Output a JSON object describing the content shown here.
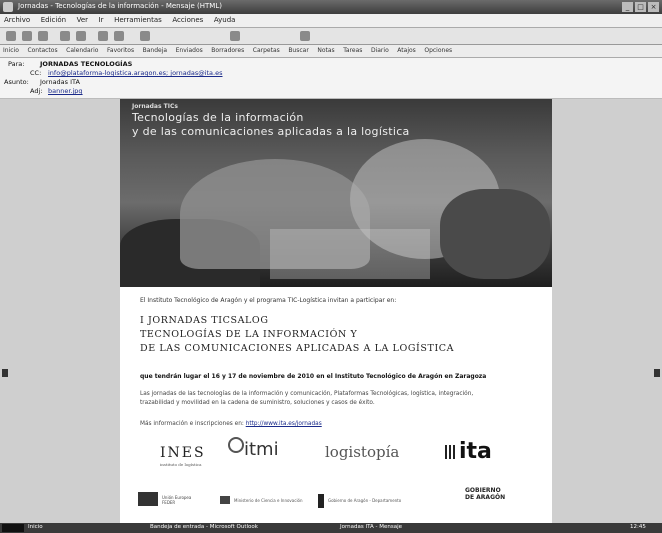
{
  "window": {
    "title": "Jornadas - Tecnologías de la información - Mensaje (HTML)"
  },
  "menu": [
    "Archivo",
    "Edición",
    "Ver",
    "Ir",
    "Herramientas",
    "Acciones",
    "Ayuda"
  ],
  "links_bar": [
    "Inicio",
    "Contactos",
    "Calendario",
    "Favoritos",
    "Bandeja",
    "Enviados",
    "Borradores",
    "Carpetas",
    "Buscar",
    "Notas",
    "Tareas",
    "Diario",
    "Atajos",
    "Opciones"
  ],
  "header": {
    "from_label": "Para:",
    "from_value": "JORNADAS TECNOLOGÍAS",
    "cc_label": "CC:",
    "cc_value": "info@plataforma-logistica.aragon.es; jornadas@ita.es",
    "subject_label": "Asunto:",
    "subject_value": "Jornadas ITA",
    "attach_label": "Adj:",
    "attach_value": "banner.jpg"
  },
  "email": {
    "banner_small": "Jornadas TICs",
    "banner_line1": "Tecnologías de la información",
    "banner_line2": "y de las comunicaciones aplicadas a la logística",
    "intro": "El Instituto Tecnológico de Aragón y el programa TIC-Logística invitan a participar en:",
    "title_line1": "I JORNADAS TICSALOG",
    "title_line2": "TECNOLOGÍAS DE LA INFORMACIÓN Y",
    "title_line3": "DE LAS COMUNICACIONES APLICADAS A LA LOGÍSTICA",
    "dates": "que tendrán lugar el 16 y 17 de noviembre de 2010 en el Instituto Tecnológico de Aragón en Zaragoza",
    "desc_line1": "Las jornadas de las tecnologías de la información y comunicación, Plataformas Tecnológicas, logística, integración,",
    "desc_line2": "trazabilidad y movilidad en la cadena de suministro, soluciones y casos de éxito.",
    "contact_text": "Más información e inscripciones en:",
    "contact_link": "http://www.ita.es/jornadas"
  },
  "logos": {
    "ines": "INES",
    "ines_sub": "instituto de logística",
    "itmi": "itmi",
    "logis": "logistopía",
    "ita": "ita"
  },
  "sponsors": {
    "eu": "Unión Europea FEDER",
    "s2": "Ministerio de Ciencia e Innovación",
    "s3": "Gobierno de Aragón - Departamento",
    "s4_line1": "GOBIERNO",
    "s4_line2": "DE ARAGÓN"
  },
  "statusbar": {
    "item1": "Inicio",
    "item2": "Bandeja de entrada - Microsoft Outlook",
    "item3": "Jornadas ITA - Mensaje",
    "clock": "12:45"
  }
}
